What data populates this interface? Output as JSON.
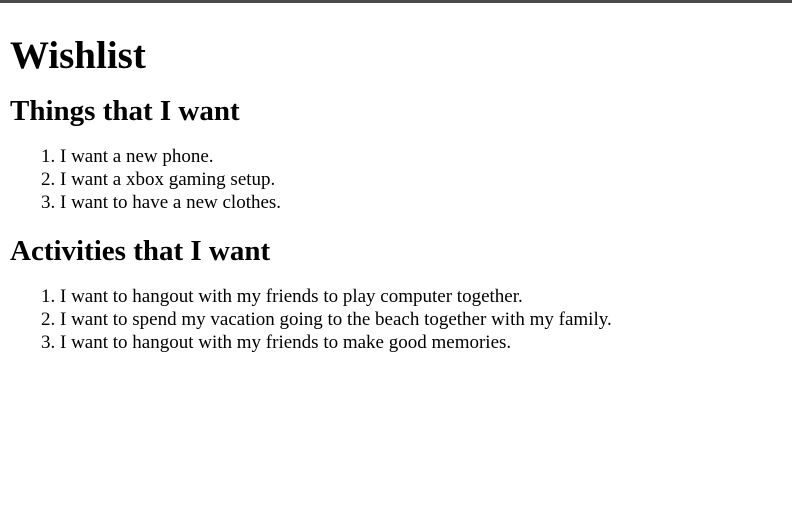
{
  "page": {
    "title": "Wishlist",
    "sections": [
      {
        "heading": "Things that I want",
        "items": [
          "I want a new phone.",
          "I want a xbox gaming setup.",
          "I want to have a new clothes."
        ]
      },
      {
        "heading": "Activities that I want",
        "items": [
          "I want to hangout with my friends to play computer together.",
          "I want to spend my vacation going to the beach together with my family.",
          "I want to hangout with my friends to make good memories."
        ]
      }
    ]
  }
}
